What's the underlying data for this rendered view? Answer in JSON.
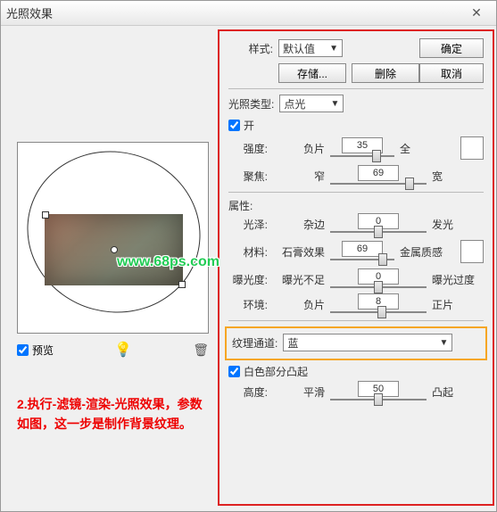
{
  "title": "光照效果",
  "buttons": {
    "ok": "确定",
    "cancel": "取消",
    "save": "存储...",
    "delete": "删除"
  },
  "style": {
    "label": "样式:",
    "value": "默认值"
  },
  "lightType": {
    "label": "光照类型:",
    "value": "点光"
  },
  "on": {
    "label": "开",
    "checked": true
  },
  "intensity": {
    "label": "强度:",
    "left": "负片",
    "right": "全",
    "value": "35",
    "pos": 72
  },
  "focus": {
    "label": "聚焦:",
    "left": "窄",
    "right": "宽",
    "value": "69",
    "pos": 82
  },
  "propsHeader": "属性:",
  "gloss": {
    "label": "光泽:",
    "left": "杂边",
    "right": "发光",
    "value": "0",
    "pos": 50
  },
  "material": {
    "label": "材料:",
    "left": "石膏效果",
    "right": "金属质感",
    "value": "69",
    "pos": 82
  },
  "exposure": {
    "label": "曝光度:",
    "left": "曝光不足",
    "right": "曝光过度",
    "value": "0",
    "pos": 50
  },
  "ambience": {
    "label": "环境:",
    "left": "负片",
    "right": "正片",
    "value": "8",
    "pos": 54
  },
  "textureChannel": {
    "label": "纹理通道:",
    "value": "蓝"
  },
  "whiteHigh": {
    "label": "白色部分凸起",
    "checked": true
  },
  "height": {
    "label": "高度:",
    "left": "平滑",
    "right": "凸起",
    "value": "50",
    "pos": 50
  },
  "preview": {
    "label": "预览",
    "checked": true
  },
  "note": "2.执行-滤镜-渲染-光照效果，参数如图，这一步是制作背景纹理。",
  "watermark": "www.68ps.com"
}
